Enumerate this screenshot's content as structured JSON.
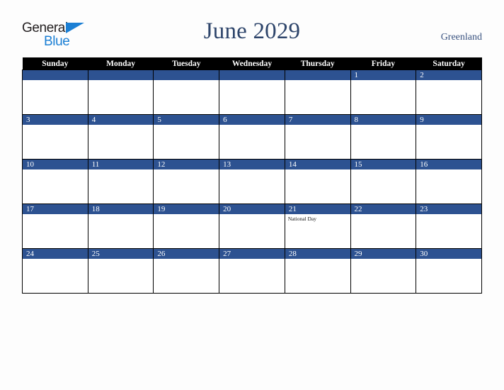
{
  "brand": {
    "line1": "General",
    "line2": "Blue",
    "triangle_color": "#1b7fd4",
    "text_color": "#231f20"
  },
  "header": {
    "title": "June 2029",
    "country": "Greenland",
    "title_color": "#2e456b"
  },
  "calendar": {
    "accent_color": "#2d5291",
    "header_bg": "#000000",
    "weekday_headers": [
      "Sunday",
      "Monday",
      "Tuesday",
      "Wednesday",
      "Thursday",
      "Friday",
      "Saturday"
    ],
    "weeks": [
      [
        {
          "day": ""
        },
        {
          "day": ""
        },
        {
          "day": ""
        },
        {
          "day": ""
        },
        {
          "day": ""
        },
        {
          "day": "1"
        },
        {
          "day": "2"
        }
      ],
      [
        {
          "day": "3"
        },
        {
          "day": "4"
        },
        {
          "day": "5"
        },
        {
          "day": "6"
        },
        {
          "day": "7"
        },
        {
          "day": "8"
        },
        {
          "day": "9"
        }
      ],
      [
        {
          "day": "10"
        },
        {
          "day": "11"
        },
        {
          "day": "12"
        },
        {
          "day": "13"
        },
        {
          "day": "14"
        },
        {
          "day": "15"
        },
        {
          "day": "16"
        }
      ],
      [
        {
          "day": "17"
        },
        {
          "day": "18"
        },
        {
          "day": "19"
        },
        {
          "day": "20"
        },
        {
          "day": "21",
          "events": [
            "National Day"
          ]
        },
        {
          "day": "22"
        },
        {
          "day": "23"
        }
      ],
      [
        {
          "day": "24"
        },
        {
          "day": "25"
        },
        {
          "day": "26"
        },
        {
          "day": "27"
        },
        {
          "day": "28"
        },
        {
          "day": "29"
        },
        {
          "day": "30"
        }
      ]
    ]
  }
}
